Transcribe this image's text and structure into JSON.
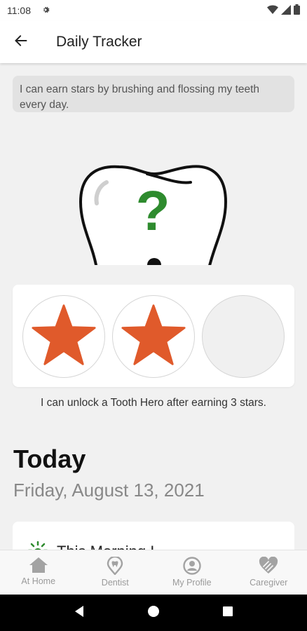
{
  "status_bar": {
    "time": "11:08"
  },
  "header": {
    "title": "Daily Tracker",
    "back_icon": "arrow-left-icon"
  },
  "info": {
    "text": "I can earn stars by brushing and flossing my teeth every day."
  },
  "tooth": {
    "symbol": "?",
    "accent_color": "#2e8b2e"
  },
  "stars": {
    "earned": 2,
    "total": 3,
    "star_color": "#e05a2b"
  },
  "unlock": {
    "text": "I can unlock a Tooth Hero after earning 3 stars."
  },
  "today": {
    "title": "Today",
    "date": "Friday, August 13, 2021"
  },
  "morning": {
    "label": "This Morning I"
  },
  "bottom_nav": {
    "items": [
      {
        "label": "At Home",
        "icon": "home-icon"
      },
      {
        "label": "Dentist",
        "icon": "tooth-pin-icon"
      },
      {
        "label": "My Profile",
        "icon": "profile-icon"
      },
      {
        "label": "Caregiver",
        "icon": "heart-hands-icon"
      }
    ]
  }
}
